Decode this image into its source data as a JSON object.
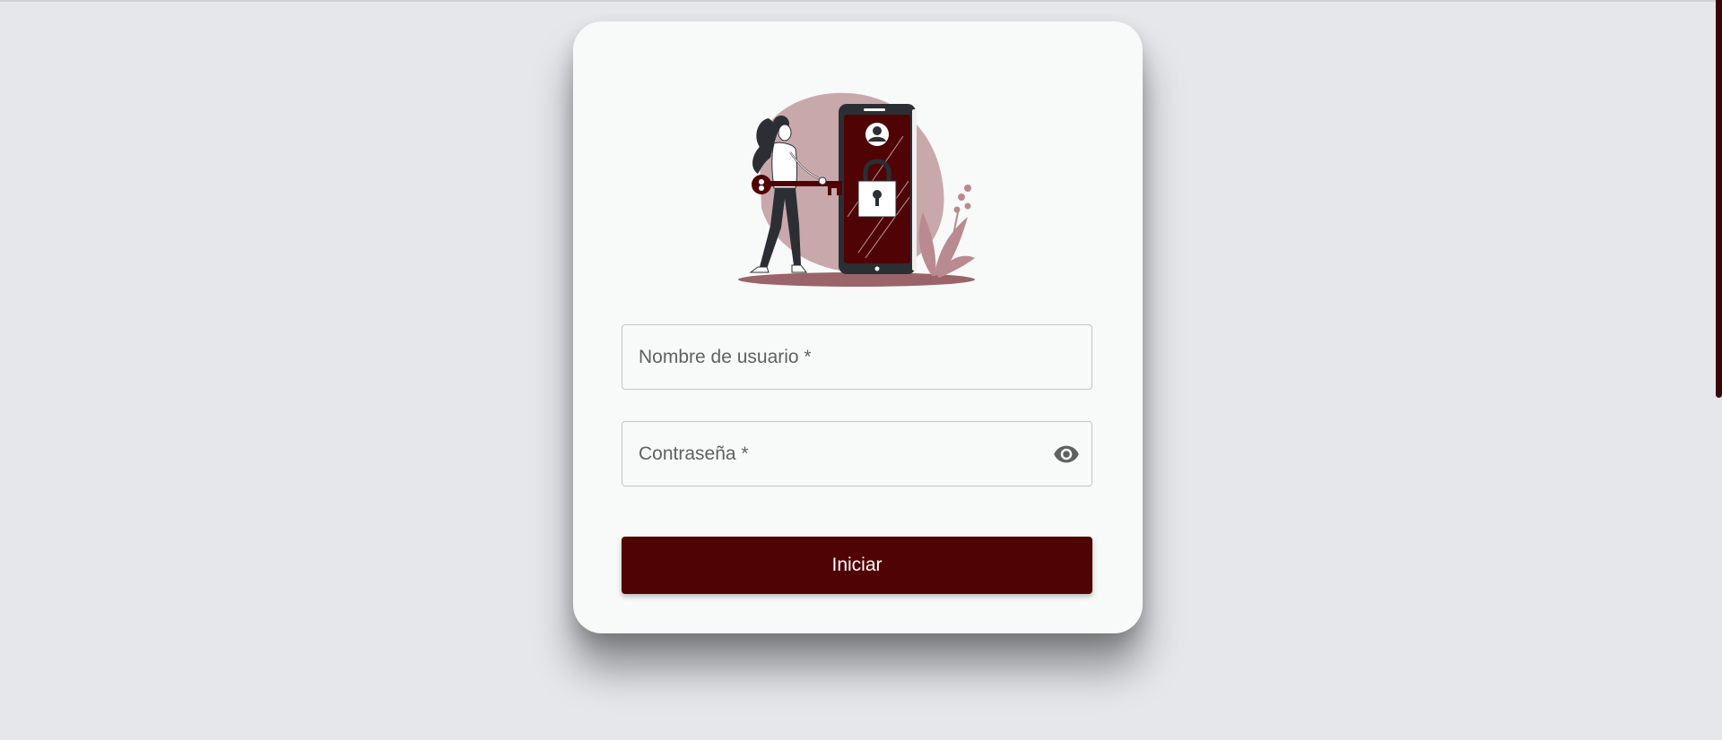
{
  "login": {
    "username": {
      "label": "Nombre de usuario *",
      "value": ""
    },
    "password": {
      "label": "Contraseña *",
      "value": "",
      "toggle_icon": "eye-icon"
    },
    "submit_label": "Iniciar"
  },
  "illustration": {
    "icon": "woman-unlocking-phone-illustration"
  },
  "colors": {
    "background": "#e5e7eb",
    "card": "#f8f9f9",
    "accent": "#500305",
    "blob": "#c9a8ac",
    "field_border": "#c4c4c4",
    "label": "#616161"
  }
}
